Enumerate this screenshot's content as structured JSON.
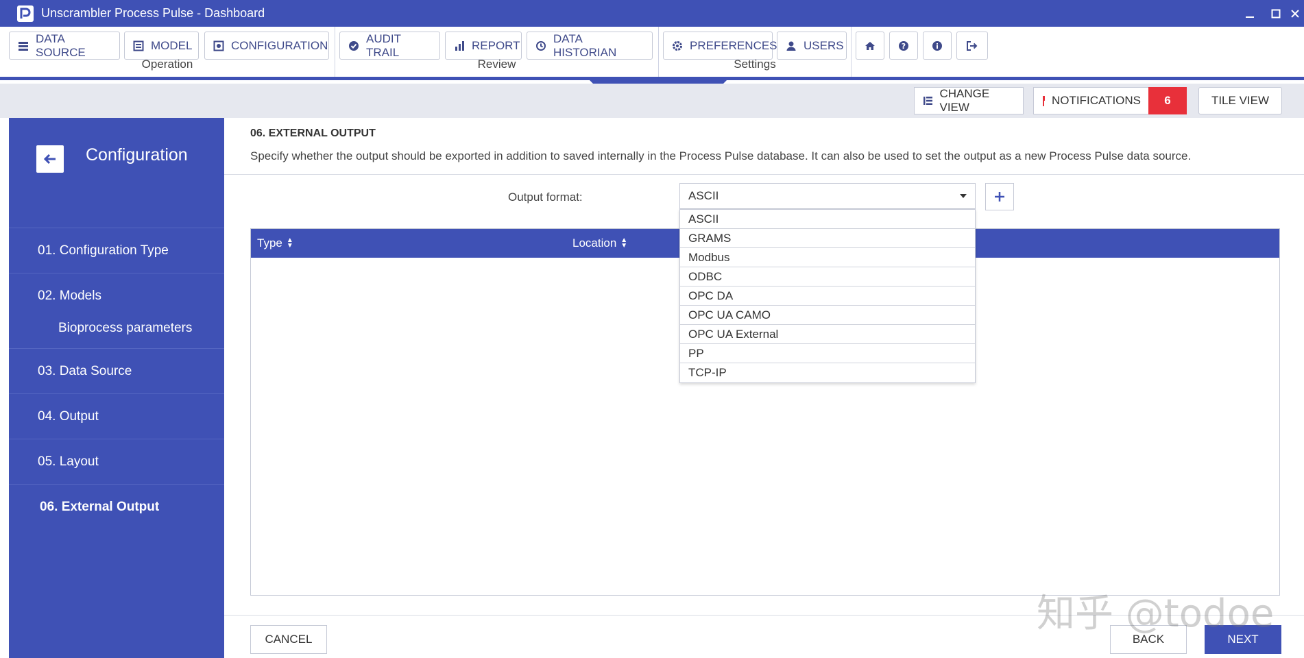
{
  "window": {
    "title": "Unscrambler Process Pulse - Dashboard"
  },
  "toolbar": {
    "groups": [
      {
        "label": "Operation",
        "buttons": [
          {
            "label": "DATA SOURCE",
            "icon": "list-icon"
          },
          {
            "label": "MODEL",
            "icon": "list-icon"
          },
          {
            "label": "CONFIGURATION",
            "icon": "config-icon"
          }
        ]
      },
      {
        "label": "Review",
        "buttons": [
          {
            "label": "AUDIT TRAIL",
            "icon": "check-circle-icon"
          },
          {
            "label": "REPORT",
            "icon": "bar-chart-icon"
          },
          {
            "label": "DATA HISTORIAN",
            "icon": "history-icon"
          }
        ]
      },
      {
        "label": "Settings",
        "buttons": [
          {
            "label": "PREFERENCES",
            "icon": "gear-icon"
          },
          {
            "label": "USERS",
            "icon": "user-icon"
          }
        ]
      }
    ],
    "icon_buttons": [
      "home-icon",
      "help-icon",
      "info-icon",
      "logout-icon"
    ]
  },
  "subbar": {
    "change_view": "CHANGE VIEW",
    "notifications": "NOTIFICATIONS",
    "notification_count": "6",
    "tile_view": "TILE VIEW"
  },
  "sidebar": {
    "title": "Configuration",
    "items": [
      {
        "label": "01. Configuration Type"
      },
      {
        "label": "02. Models",
        "sub": "Bioprocess parameters"
      },
      {
        "label": "03. Data Source"
      },
      {
        "label": "04. Output"
      },
      {
        "label": "05. Layout"
      },
      {
        "label": "06. External Output",
        "active": true
      }
    ]
  },
  "main": {
    "heading": "06. EXTERNAL OUTPUT",
    "description": "Specify whether the output should be exported in addition to saved internally in the Process Pulse database. It can also be used to set the output as a new Process Pulse data source.",
    "output_format_label": "Output format:",
    "output_format_value": "ASCII",
    "options": [
      "ASCII",
      "GRAMS",
      "Modbus",
      "ODBC",
      "OPC DA",
      "OPC UA CAMO",
      "OPC UA External",
      "PP",
      "TCP-IP"
    ],
    "table_columns": [
      "Type",
      "Location"
    ],
    "footer": {
      "cancel": "CANCEL",
      "back": "BACK",
      "next": "NEXT"
    }
  },
  "watermark": "知乎 @todoe",
  "colors": {
    "primary": "#3f51b5",
    "notification_badge": "#e8303a"
  }
}
